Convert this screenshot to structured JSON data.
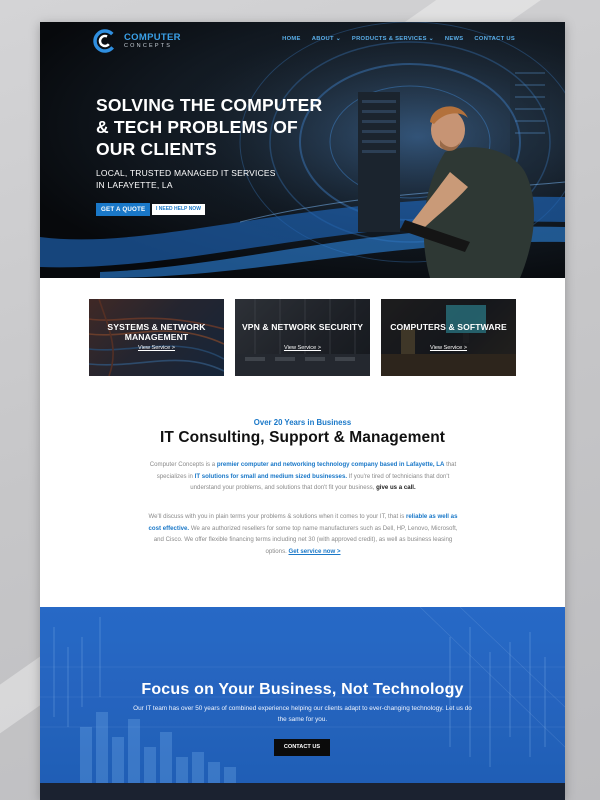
{
  "nav": {
    "logo": {
      "line1": "COMPUTER",
      "line2": "CONCEPTS"
    },
    "items": [
      {
        "label": "HOME"
      },
      {
        "label": "ABOUT ⌄"
      },
      {
        "label": "PRODUCTS & SERVICES ⌄"
      },
      {
        "label": "NEWS"
      },
      {
        "label": "CONTACT US"
      }
    ]
  },
  "hero": {
    "title": "SOLVING THE COMPUTER & TECH PROBLEMS OF OUR CLIENTS",
    "subtitle": "LOCAL, TRUSTED MANAGED IT SERVICES IN LAFAYETTE, LA",
    "primary_button": "GET A QUOTE",
    "secondary_button": "I NEED HELP NOW"
  },
  "services": [
    {
      "title": "SYSTEMS & NETWORK MANAGEMENT",
      "link": "View Service >"
    },
    {
      "title": "VPN & NETWORK SECURITY",
      "link": "View Service >"
    },
    {
      "title": "COMPUTERS & SOFTWARE",
      "link": "View Service >"
    }
  ],
  "about": {
    "eyebrow": "Over 20 Years in Business",
    "title": "IT Consulting, Support & Management",
    "p1": {
      "a": "Computer Concepts is a ",
      "b": "premier computer and networking technology company based in Lafayette, LA",
      "c": " that specializes in ",
      "d": "IT solutions for small and medium sized businesses.",
      "e": " If you're tired of technicians that don't understand your problems, and solutions that don't fit your business, ",
      "f": "give us a call."
    },
    "p2": {
      "a": "We'll discuss with you in plain terms your problems & solutions when it comes to your IT, that is ",
      "b": "reliable as well as cost effective.",
      "c": " We are authorized resellers for some top name manufacturers such as Dell, HP, Lenovo, Microsoft, and Cisco. We offer flexible financing terms including net 30 (with approved credit), as well as business leasing options. ",
      "d": "Get service now >"
    }
  },
  "band": {
    "title": "Focus on Your Business, Not Technology",
    "text": "Our IT team has over 50 years of combined experience helping our clients adapt to ever-changing technology. Let us do the same for you.",
    "button": "CONTACT US"
  },
  "colors": {
    "accent": "#1a78c8",
    "band_blue": "#2766c2",
    "hero_dark": "#07090c"
  }
}
